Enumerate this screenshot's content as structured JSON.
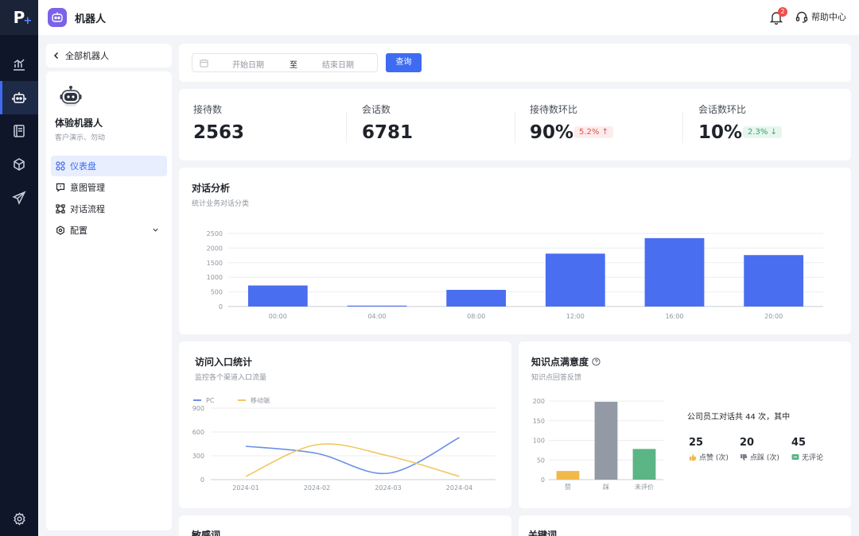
{
  "app": {
    "logo_text": "P",
    "title": "机器人"
  },
  "header": {
    "notification_count": "2",
    "help_label": "帮助中心"
  },
  "nav": {
    "back_label": "全部机器人"
  },
  "robot": {
    "name": "体验机器人",
    "description": "客户演示、勿动"
  },
  "menu": [
    {
      "label": "仪表盘",
      "icon": "dashboard-icon",
      "selected": true
    },
    {
      "label": "意图管理",
      "icon": "intent-icon",
      "selected": false
    },
    {
      "label": "对话流程",
      "icon": "flow-icon",
      "selected": false
    },
    {
      "label": "配置",
      "icon": "settings-icon",
      "selected": false
    }
  ],
  "filter": {
    "start_placeholder": "开始日期",
    "separator": "至",
    "end_placeholder": "结束日期",
    "query_label": "查询"
  },
  "stats": [
    {
      "label": "接待数",
      "value": "2563"
    },
    {
      "label": "会话数",
      "value": "6781"
    },
    {
      "label": "接待数环比",
      "value": "90%",
      "change": "5.2%",
      "direction": "up"
    },
    {
      "label": "会话数环比",
      "value": "10%",
      "change": "2.3%",
      "direction": "down"
    }
  ],
  "colors": {
    "primary": "#3e6bf2",
    "up_bg": "#fdecec",
    "up_text": "#e0504b",
    "down_bg": "#e6f6ee",
    "down_text": "#2aa86a"
  },
  "dialog_analysis": {
    "title": "对话分析",
    "subtitle": "统计业务对话分类"
  },
  "entry_stats": {
    "title": "访问入口统计",
    "subtitle": "监控各个渠道入口流量"
  },
  "knowledge": {
    "title": "知识点满意度",
    "subtitle": "知识点回答反馈",
    "summary": "公司员工对话共 44 次，其中",
    "items": [
      {
        "value": "25",
        "label": "点赞 (次)",
        "color": "#f0b94a"
      },
      {
        "value": "20",
        "label": "点踩 (次)",
        "color": "#7a808a"
      },
      {
        "value": "45",
        "label": "无评论",
        "color": "#5bb585"
      }
    ]
  },
  "bottom": {
    "left_title": "敏感词",
    "right_title": "关键词"
  },
  "chart_data": [
    {
      "type": "bar",
      "categories": [
        "00:00",
        "04:00",
        "08:00",
        "12:00",
        "16:00",
        "20:00"
      ],
      "values": [
        720,
        30,
        570,
        1810,
        2340,
        1760
      ],
      "yticks": [
        0,
        500,
        1000,
        1500,
        2000,
        2500
      ],
      "ylim": [
        0,
        2500
      ],
      "color": "#4a6ef0"
    },
    {
      "type": "line",
      "categories": [
        "2024-01",
        "2024-02",
        "2024-03",
        "2024-04"
      ],
      "series": [
        {
          "name": "PC",
          "values": [
            420,
            330,
            80,
            530
          ],
          "color": "#6b8ee8"
        },
        {
          "name": "移动端",
          "values": [
            40,
            440,
            300,
            40
          ],
          "color": "#f0c860"
        }
      ],
      "yticks": [
        0,
        300,
        600,
        900
      ],
      "ylim": [
        0,
        900
      ]
    },
    {
      "type": "bar",
      "categories": [
        "赞",
        "踩",
        "未评价"
      ],
      "values": [
        22,
        198,
        78
      ],
      "colors": [
        "#f0b94a",
        "#939aa5",
        "#5bb585"
      ],
      "yticks": [
        0,
        50,
        100,
        150,
        200
      ],
      "ylim": [
        0,
        200
      ]
    }
  ]
}
